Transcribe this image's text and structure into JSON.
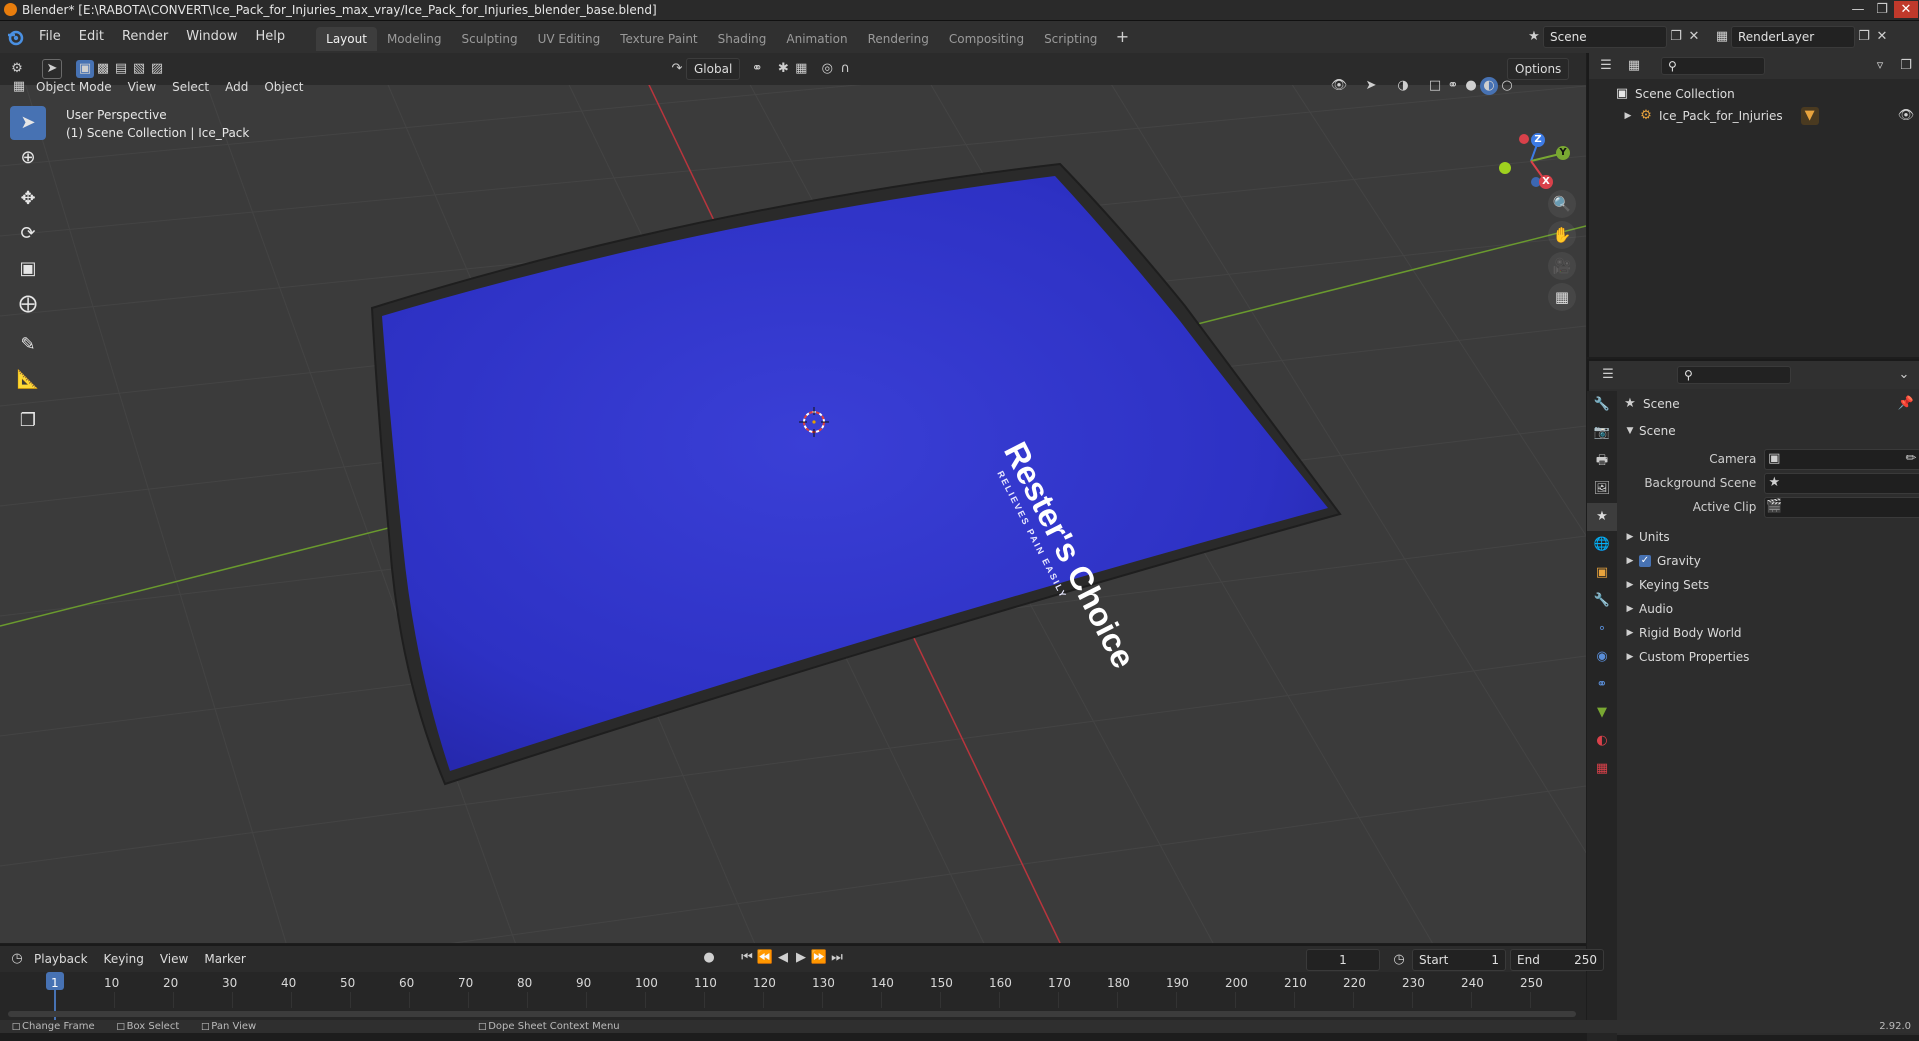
{
  "window": {
    "title": "Blender* [E:\\RABOTA\\CONVERT\\Ice_Pack_for_Injuries_max_vray/Ice_Pack_for_Injuries_blender_base.blend]"
  },
  "menu": [
    "File",
    "Edit",
    "Render",
    "Window",
    "Help"
  ],
  "workspaces": [
    {
      "label": "Layout",
      "active": true
    },
    {
      "label": "Modeling"
    },
    {
      "label": "Sculpting"
    },
    {
      "label": "UV Editing"
    },
    {
      "label": "Texture Paint"
    },
    {
      "label": "Shading"
    },
    {
      "label": "Animation"
    },
    {
      "label": "Rendering"
    },
    {
      "label": "Compositing"
    },
    {
      "label": "Scripting"
    }
  ],
  "scene_field": "Scene",
  "render_layer_field": "RenderLayer",
  "viewport_header": {
    "mode": "Object Mode",
    "menus": [
      "View",
      "Select",
      "Add",
      "Object"
    ],
    "orientation": "Global",
    "options": "Options"
  },
  "viewport": {
    "perspective": "User Perspective",
    "collection_info": "(1) Scene Collection | Ice_Pack",
    "brand_text": "Rester's Choice",
    "brand_tagline": "RELIEVES PAIN EASILY",
    "gizmo": {
      "x": "X",
      "y": "Y",
      "z": "Z"
    }
  },
  "outliner": {
    "root": "Scene Collection",
    "items": [
      "Ice_Pack_for_Injuries"
    ]
  },
  "properties": {
    "header": "Scene",
    "section": "Scene",
    "fields": [
      {
        "label": "Camera"
      },
      {
        "label": "Background Scene"
      },
      {
        "label": "Active Clip"
      }
    ],
    "panels": [
      {
        "label": "Units",
        "checkbox": false
      },
      {
        "label": "Gravity",
        "checkbox": true
      },
      {
        "label": "Keying Sets",
        "checkbox": false
      },
      {
        "label": "Audio",
        "checkbox": false
      },
      {
        "label": "Rigid Body World",
        "checkbox": false
      },
      {
        "label": "Custom Properties",
        "checkbox": false
      }
    ]
  },
  "timeline": {
    "menus": [
      "Playback",
      "Keying",
      "View",
      "Marker"
    ],
    "current_frame": "1",
    "start_label": "Start",
    "start": "1",
    "end_label": "End",
    "end": "250",
    "ruler": [
      "1",
      "10",
      "20",
      "30",
      "40",
      "50",
      "60",
      "70",
      "80",
      "90",
      "100",
      "110",
      "120",
      "130",
      "140",
      "150",
      "160",
      "170",
      "180",
      "190",
      "200",
      "210",
      "220",
      "230",
      "240",
      "250"
    ]
  },
  "statusbar": {
    "items": [
      "Change Frame",
      "Box Select",
      "Pan View",
      "Dope Sheet Context Menu"
    ],
    "version": "2.92.0"
  },
  "colors": {
    "accent": "#4772b3",
    "pack_blue": "#2f32c8",
    "x_axis": "#d9414a",
    "y_axis": "#79a832",
    "z_axis": "#3d7be5"
  }
}
